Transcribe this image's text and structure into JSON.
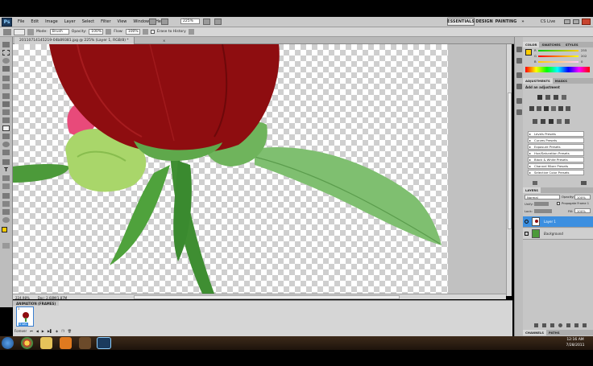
{
  "menubar": {
    "logo": "Ps",
    "items": [
      "File",
      "Edit",
      "Image",
      "Layer",
      "Select",
      "Filter",
      "View",
      "Window",
      "Help"
    ],
    "zoom_value": "225%",
    "workspaces": [
      "ESSENTIALS",
      "DESIGN",
      "PAINTING",
      "»"
    ],
    "cs_live": "CS Live"
  },
  "options": {
    "mode_label": "Mode:",
    "mode_value": "Brush",
    "opacity_label": "Opacity:",
    "opacity_value": "100%",
    "flow_label": "Flow:",
    "flow_value": "100%",
    "erase_label": "Erase to History"
  },
  "document": {
    "tab_title": "20110714145219-04b89381.jpg @ 225% (Layer 1, RGB/8) *",
    "zoom_status": "224.98%",
    "doc_status": "Doc: 2.60M/1.87M"
  },
  "animation": {
    "tab_label": "ANIMATION (FRAMES)",
    "frame_number": "1",
    "frame_delay": "0 sec.",
    "loop_value": "Forever"
  },
  "color_panel": {
    "tabs": [
      "COLOR",
      "SWATCHES",
      "STYLES"
    ],
    "values": [
      {
        "label": "R",
        "value": "255"
      },
      {
        "label": "G",
        "value": "202"
      },
      {
        "label": "B",
        "value": "0"
      }
    ],
    "foreground": "#ffcc00"
  },
  "adjustments_panel": {
    "tabs": [
      "ADJUSTMENTS",
      "MASKS"
    ],
    "heading": "Add an adjustment",
    "presets": [
      "Levels Presets",
      "Curves Presets",
      "Exposure Presets",
      "Hue/Saturation Presets",
      "Black & White Presets",
      "Channel Mixer Presets",
      "Selective Color Presets"
    ]
  },
  "layers_panel": {
    "tab": "LAYERS",
    "blend_mode": "Normal",
    "opacity_label": "Opacity:",
    "opacity_value": "100%",
    "unify_label": "Unify:",
    "propagate_label": "Propagate Frame 1",
    "lock_label": "Lock:",
    "fill_label": "Fill:",
    "fill_value": "100%",
    "layers": [
      {
        "name": "Layer 1",
        "selected": true
      },
      {
        "name": "Background",
        "selected": false
      }
    ],
    "bottom_tabs": [
      "CHANNELS",
      "PATHS"
    ]
  },
  "taskbar": {
    "time": "12:16 AM",
    "date": "7/28/2011"
  },
  "colors": {
    "accent_blue": "#3c8fe0",
    "selected_layer": "#7cb8f0",
    "taskbar": "#2e1f12"
  }
}
